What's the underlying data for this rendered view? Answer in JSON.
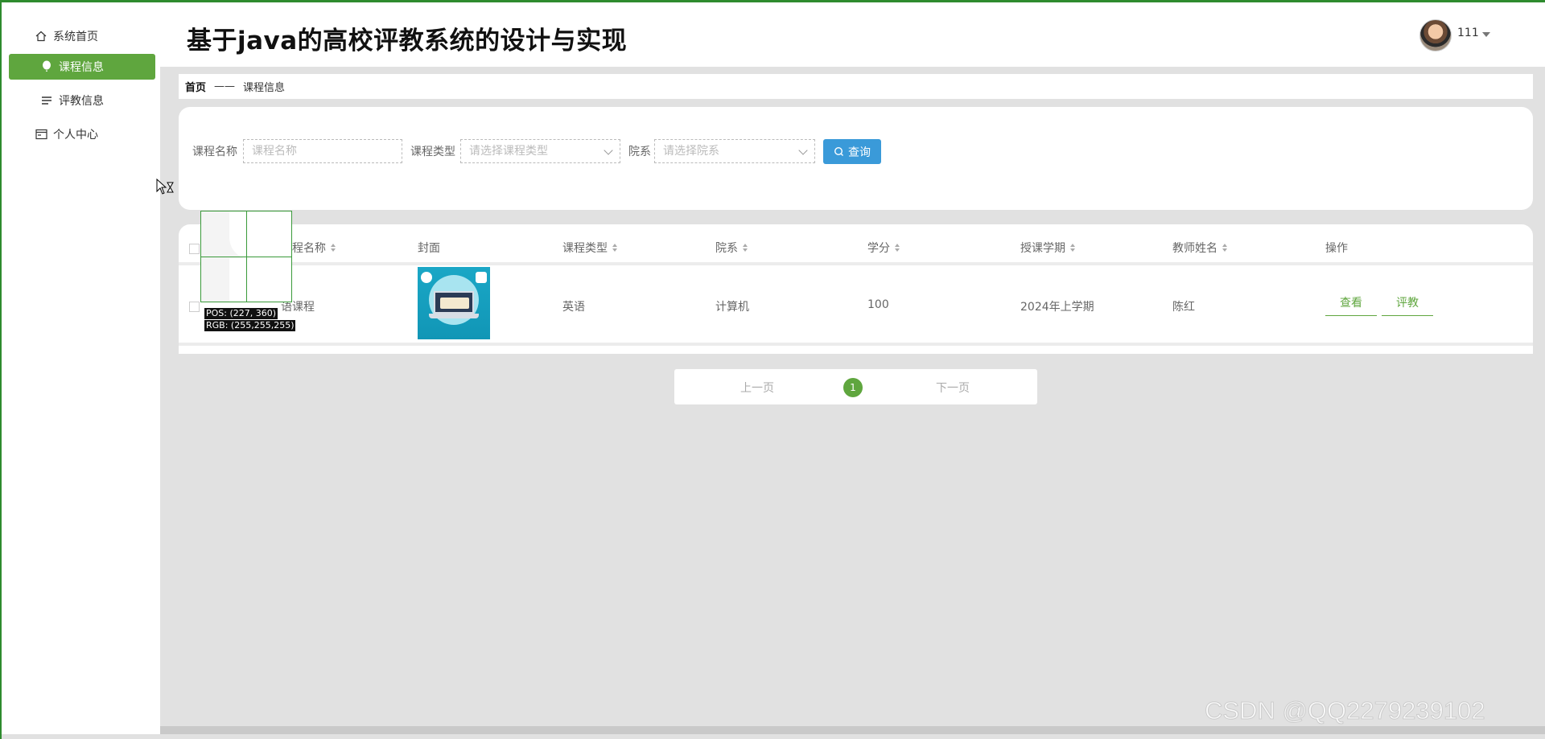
{
  "sidebar": {
    "items": [
      {
        "label": "系统首页",
        "icon": "home-icon"
      },
      {
        "label": "课程信息",
        "icon": "balloon-icon",
        "active": true
      },
      {
        "label": "评教信息",
        "icon": "list-icon"
      },
      {
        "label": "个人中心",
        "icon": "card-icon"
      }
    ]
  },
  "header": {
    "title": "基于java的高校评教系统的设计与实现",
    "username": "111"
  },
  "breadcrumb": {
    "home": "首页",
    "separator": "——",
    "current": "课程信息"
  },
  "search": {
    "course_name_label": "课程名称",
    "course_name_placeholder": "课程名称",
    "course_type_label": "课程类型",
    "course_type_placeholder": "请选择课程类型",
    "department_label": "院系",
    "department_placeholder": "请选择院系",
    "query_label": "查询"
  },
  "table": {
    "columns": [
      "课程名称",
      "封面",
      "课程类型",
      "院系",
      "学分",
      "授课学期",
      "教师姓名",
      "操作"
    ],
    "rows": [
      {
        "name": "语课程",
        "course_type": "英语",
        "department": "计算机",
        "credits": "100",
        "semester": "2024年上学期",
        "teacher": "陈红",
        "actions": [
          "查看",
          "评教"
        ]
      }
    ]
  },
  "pagination": {
    "prev": "上一页",
    "current": "1",
    "next": "下一页"
  },
  "overlay": {
    "pos": "POS: (227, 360)",
    "rgb": "RGB: (255,255,255)"
  },
  "watermark": "CSDN @QQ2279239102",
  "colors": {
    "accent": "#5fa63e",
    "query_button": "#3a9ad9"
  }
}
